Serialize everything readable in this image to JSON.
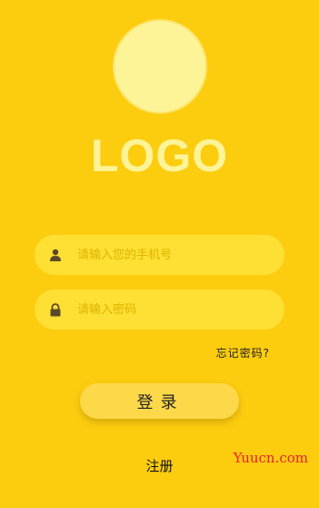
{
  "logo": {
    "text": "LOGO"
  },
  "phone_field": {
    "placeholder": "请输入您的手机号",
    "value": "",
    "icon": "person-icon"
  },
  "password_field": {
    "placeholder": "请输入密码",
    "value": "",
    "icon": "lock-icon"
  },
  "forgot_label": "忘记密码?",
  "login_label": "登录",
  "register_label": "注册",
  "watermark": "Yuucn.com",
  "colors": {
    "background": "#fccc0f",
    "avatar": "#fdf497",
    "field_bg": "#fde033",
    "placeholder": "#e0b300",
    "button_bg": "#fdd94a",
    "watermark": "#e8222f"
  }
}
